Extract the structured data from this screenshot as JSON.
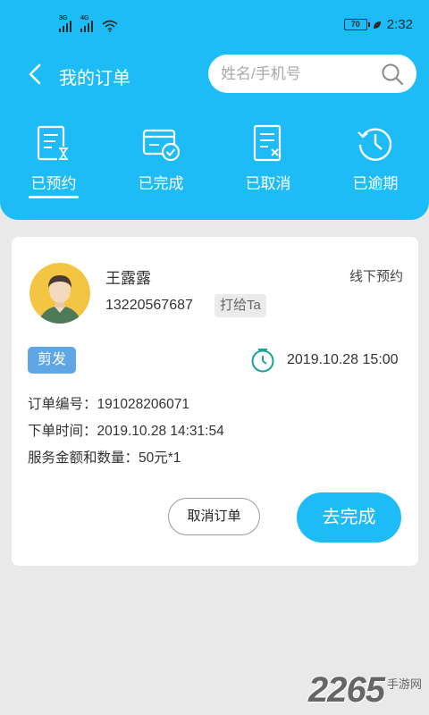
{
  "status_bar": {
    "network_1": "3G",
    "network_2": "4G",
    "battery_level": "70",
    "time": "2:32"
  },
  "header": {
    "title": "我的订单",
    "search_placeholder": "姓名/手机号"
  },
  "tabs": [
    {
      "label": "已预约",
      "icon": "hourglass-document-icon",
      "active": true
    },
    {
      "label": "已完成",
      "icon": "card-check-icon",
      "active": false
    },
    {
      "label": "已取消",
      "icon": "document-x-icon",
      "active": false
    },
    {
      "label": "已逾期",
      "icon": "clock-icon",
      "active": false
    }
  ],
  "order": {
    "customer_name": "王露露",
    "order_type": "线下预约",
    "phone": "13220567687",
    "call_label": "打给Ta",
    "service_tag": "剪发",
    "appointment_time": "2019.10.28 15:00",
    "order_number": "订单编号：191028206071",
    "order_time": "下单时间：2019.10.28 14:31:54",
    "amount": "服务金额和数量：50元*1",
    "cancel_label": "取消订单",
    "finish_label": "去完成"
  },
  "watermark": {
    "number": "2265",
    "text": "手游网"
  },
  "colors": {
    "accent": "#1ebcf6",
    "tag": "#5fa6e4",
    "clock_teal": "#1aa39a"
  }
}
